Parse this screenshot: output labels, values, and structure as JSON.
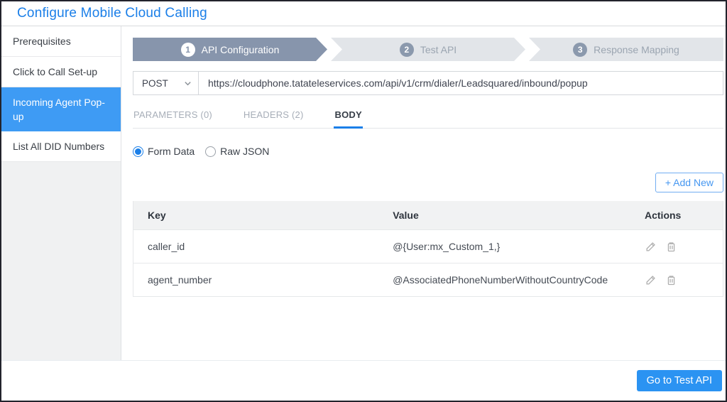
{
  "page_title": "Configure Mobile Cloud Calling",
  "sidebar": {
    "items": [
      {
        "label": "Prerequisites",
        "selected": false
      },
      {
        "label": "Click to Call Set-up",
        "selected": false
      },
      {
        "label": "Incoming Agent Pop-up",
        "selected": true
      },
      {
        "label": "List All DID Numbers",
        "selected": false
      }
    ]
  },
  "stepper": {
    "steps": [
      {
        "number": "1",
        "label": "API Configuration",
        "state": "active"
      },
      {
        "number": "2",
        "label": "Test API",
        "state": "inactive"
      },
      {
        "number": "3",
        "label": "Response Mapping",
        "state": "inactive"
      }
    ]
  },
  "request": {
    "method": "POST",
    "url": "https://cloudphone.tatateleservices.com/api/v1/crm/dialer/Leadsquared/inbound/popup"
  },
  "tabs": [
    {
      "label": "PARAMETERS (0)",
      "active": false
    },
    {
      "label": "HEADERS (2)",
      "active": false
    },
    {
      "label": "BODY",
      "active": true
    }
  ],
  "body_type": {
    "options": [
      {
        "label": "Form Data",
        "selected": true
      },
      {
        "label": "Raw JSON",
        "selected": false
      }
    ]
  },
  "add_new_label": "+ Add New",
  "table": {
    "columns": [
      "Key",
      "Value",
      "Actions"
    ],
    "rows": [
      {
        "key": "caller_id",
        "value": "@{User:mx_Custom_1,}"
      },
      {
        "key": "agent_number",
        "value": "@AssociatedPhoneNumberWithoutCountryCode"
      }
    ]
  },
  "footer": {
    "go_to_test_api": "Go to Test API"
  },
  "colors": {
    "title_blue": "#1b7fe8",
    "sidebar_selected_blue": "#3e9bf4",
    "step_active_bg": "#8795ac",
    "step_inactive_bg": "#e2e5e9",
    "tab_underline": "#1b7fe8",
    "add_new_blue": "#4697f1",
    "primary_button_blue": "#2b93f2",
    "table_header_bg": "#f1f2f3"
  }
}
